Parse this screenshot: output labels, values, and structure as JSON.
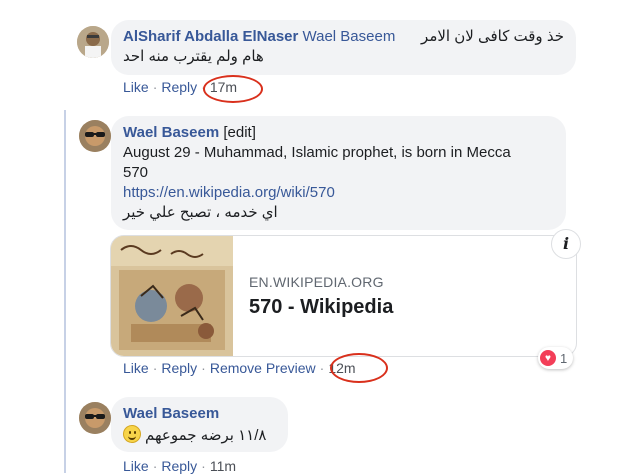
{
  "comment1": {
    "author": "AlSharif Abdalla ElNaser",
    "mention": "Wael Baseem",
    "text_line1": "خذ وقت كافى لان الامر",
    "text_line2": "هام ولم يقترب منه احد",
    "like": "Like",
    "reply": "Reply",
    "time": "17m"
  },
  "comment2": {
    "author": "Wael Baseem",
    "edit": "[edit]",
    "text_line1": "August 29 - Muhammad, Islamic prophet, is born in Mecca",
    "text_line2": "570",
    "link": "https://en.wikipedia.org/wiki/570",
    "arabic": "اي خدمه ، تصبح علي خير",
    "preview": {
      "domain": "EN.WIKIPEDIA.ORG",
      "title": "570 - Wikipedia"
    },
    "info_label": "i",
    "reaction_count": "1",
    "like": "Like",
    "reply": "Reply",
    "remove_preview": "Remove Preview",
    "time": "12m"
  },
  "comment3": {
    "author": "Wael Baseem",
    "text": "١١/٨ برضه جموعهم",
    "like": "Like",
    "reply": "Reply",
    "time": "11m"
  },
  "sep": "·",
  "colors": {
    "link": "#385898",
    "bubble": "#f2f3f5",
    "annotation": "#d9301c",
    "heart": "#f33e58"
  }
}
